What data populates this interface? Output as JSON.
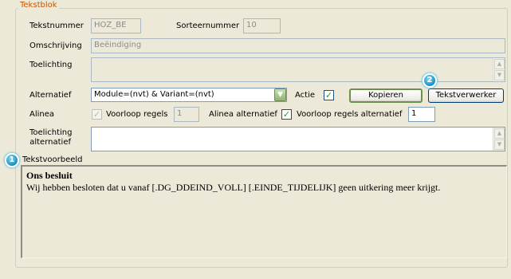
{
  "groupbox": {
    "title": "Tekstblok"
  },
  "labels": {
    "tekstnummer": "Tekstnummer",
    "sorteernummer": "Sorteernummer",
    "omschrijving": "Omschrijving",
    "toelichting": "Toelichting",
    "alternatief": "Alternatief",
    "actie": "Actie",
    "alinea": "Alinea",
    "voorloop_regels": "Voorloop regels",
    "alinea_alternatief": "Alinea alternatief",
    "voorloop_regels_alternatief": "Voorloop regels alternatief",
    "toelichting_alternatief_1": "Toelichting",
    "toelichting_alternatief_2": "alternatief",
    "tekstvoorbeeld": "Tekstvoorbeeld"
  },
  "fields": {
    "tekstnummer": "HOZ_BE",
    "sorteernummer": "10",
    "omschrijving": "Beëindiging",
    "toelichting": "",
    "alternatief": "Module=(nvt) & Variant=(nvt)",
    "voorloop_regels": "1",
    "voorloop_regels_alternatief": "1",
    "toelichting_alternatief": ""
  },
  "checkboxes": {
    "actie": true,
    "voorloop_regels": true,
    "voorloop_regels_alternatief": true
  },
  "buttons": {
    "kopieren": "Kopieren",
    "tekstverwerker": "Tekstverwerker"
  },
  "preview": {
    "title": "Ons besluit",
    "body": "Wij hebben besloten dat u vanaf [.DG_DDEIND_VOLL] [.EINDE_TIJDELIJK] geen uitkering meer krijgt."
  },
  "callouts": {
    "one": "1",
    "two": "2"
  },
  "colors": {
    "legend": "#c05800",
    "background": "#ece9d8",
    "callout": "#1a8fc0"
  }
}
